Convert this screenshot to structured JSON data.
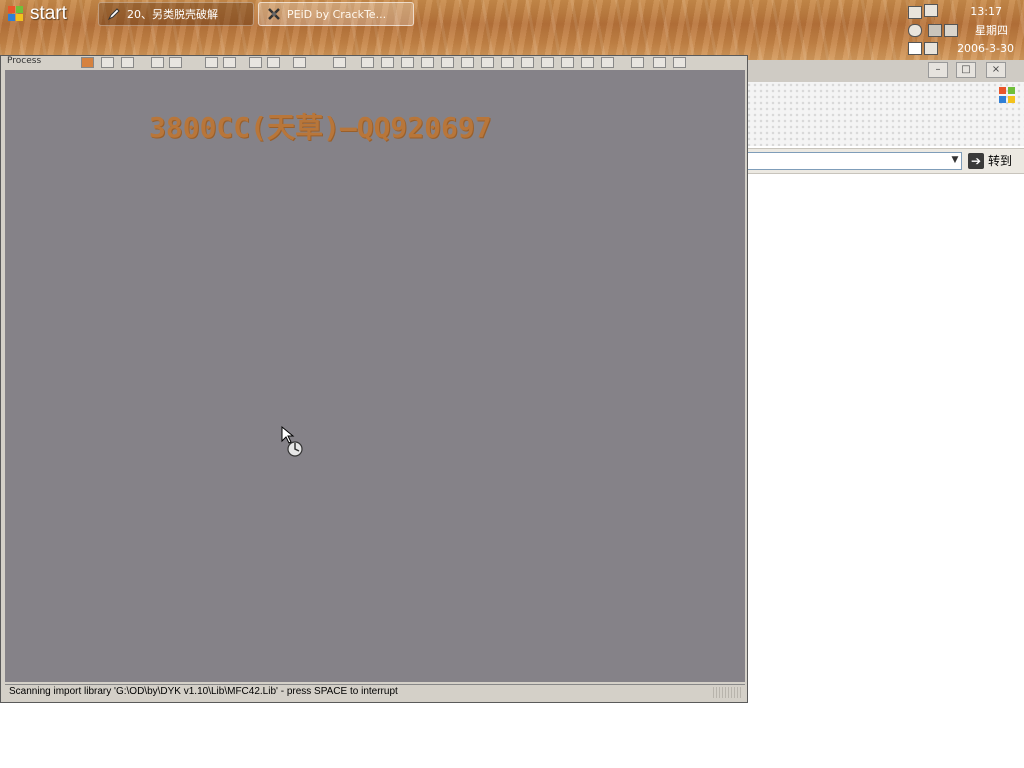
{
  "taskbar": {
    "start_label": "start",
    "tasks": [
      {
        "label": "20、另类脱壳破解",
        "icon": "pencil-icon"
      },
      {
        "label": "PEiD by CrackTe...",
        "icon": "tool-icon"
      }
    ],
    "clock": {
      "time": "13:17",
      "day": "星期四",
      "date": "2006-3-30"
    }
  },
  "browser": {
    "go_label": "转到",
    "address_value": ""
  },
  "main_window": {
    "toolbar_label": "Process",
    "watermark": "3800CC(天草)—QQ920697",
    "status_text": "Scanning import library 'G:\\OD\\by\\DYK v1.10\\Lib\\MFC42.Lib' - press SPACE to interrupt"
  },
  "colors": {
    "taskbar": "#c07c40",
    "canvas": "#858288",
    "watermark": "#b8763a",
    "window_chrome": "#d4d0c8"
  }
}
